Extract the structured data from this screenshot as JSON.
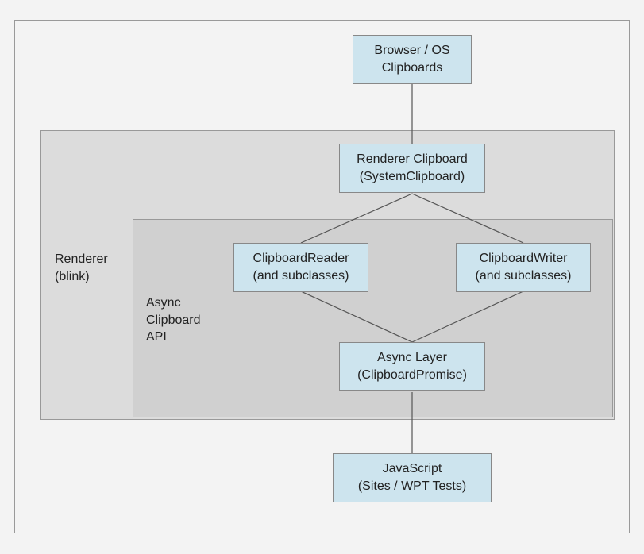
{
  "diagram": {
    "boxes": {
      "browser_os": {
        "line1": "Browser / OS",
        "line2": "Clipboards"
      },
      "renderer_clipboard": {
        "line1": "Renderer Clipboard",
        "line2": "(SystemClipboard)"
      },
      "clipboard_reader": {
        "line1": "ClipboardReader",
        "line2": "(and subclasses)"
      },
      "clipboard_writer": {
        "line1": "ClipboardWriter",
        "line2": "(and subclasses)"
      },
      "async_layer": {
        "line1": "Async Layer",
        "line2": "(ClipboardPromise)"
      },
      "javascript": {
        "line1": "JavaScript",
        "line2": "(Sites / WPT Tests)"
      }
    },
    "labels": {
      "renderer": {
        "line1": "Renderer",
        "line2": "(blink)"
      },
      "async_api": {
        "line1": "Async",
        "line2": "Clipboard",
        "line3": "API"
      }
    }
  }
}
